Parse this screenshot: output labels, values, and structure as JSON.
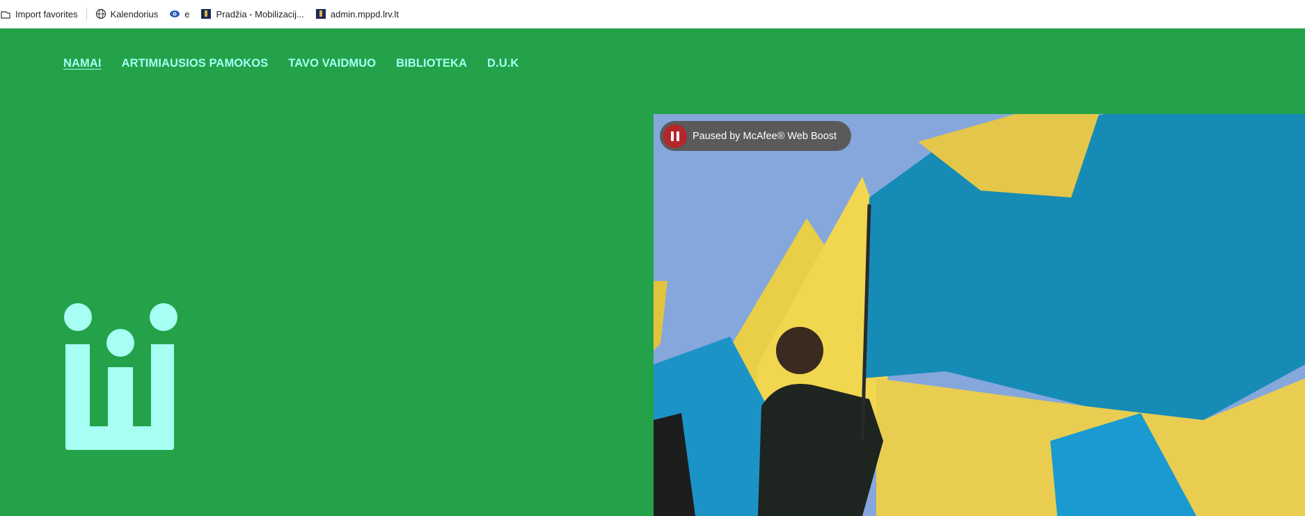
{
  "bookmarks": [
    {
      "label": "Import favorites",
      "icon": "import-icon"
    },
    {
      "label": "Kalendorius",
      "icon": "globe-icon"
    },
    {
      "label": "e",
      "icon": "eye-icon"
    },
    {
      "label": "Pradžia - Mobilizacij...",
      "icon": "site-favicon"
    },
    {
      "label": "admin.mppd.lrv.lt",
      "icon": "site-favicon"
    }
  ],
  "nav": {
    "items": [
      "NAMAI",
      "ARTIMIAUSIOS PAMOKOS",
      "TAVO VAIDMUO",
      "BIBLIOTEKA",
      "D.U.K"
    ],
    "active": "NAMAI"
  },
  "overlay": {
    "paused_text": "Paused by McAfee® Web Boost"
  },
  "colors": {
    "background": "#23a24a",
    "nav_text": "#a6fff2",
    "logo": "#a6fff2",
    "pause_button": "#b5262b"
  }
}
